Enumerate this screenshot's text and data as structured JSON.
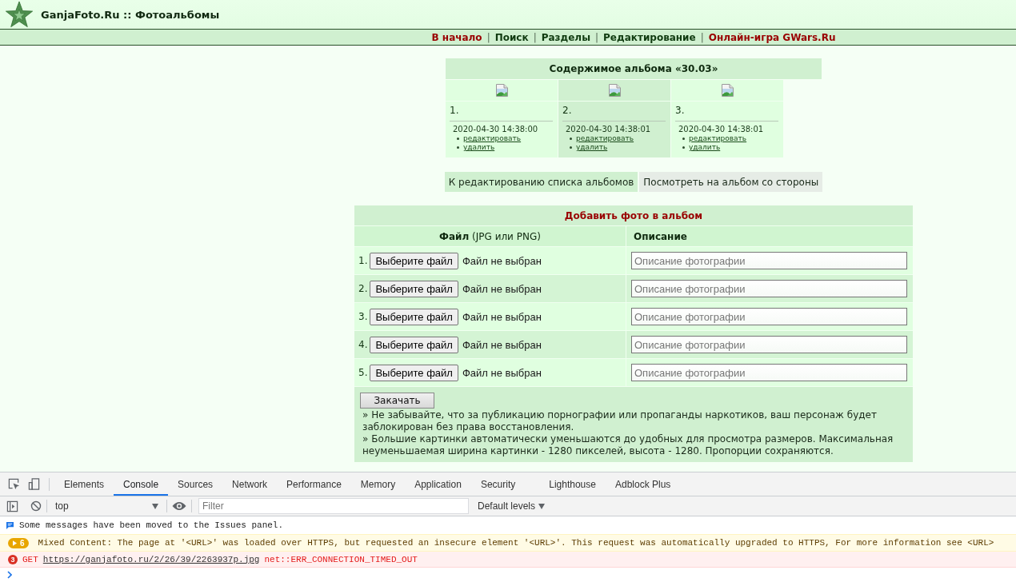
{
  "header": {
    "title": "GanjaFoto.Ru :: Фотоальбомы"
  },
  "nav": [
    {
      "label": "В начало",
      "kind": "accent"
    },
    {
      "label": "|",
      "kind": "separator"
    },
    {
      "label": "Поиск",
      "kind": "link"
    },
    {
      "label": "|",
      "kind": "separator"
    },
    {
      "label": "Разделы",
      "kind": "link"
    },
    {
      "label": "|",
      "kind": "separator"
    },
    {
      "label": "Редактирование",
      "kind": "link"
    },
    {
      "label": "|",
      "kind": "separator"
    },
    {
      "label": "Онлайн-игра GWars.Ru",
      "kind": "accent"
    }
  ],
  "album": {
    "title": "Содержимое альбома «30.03»",
    "photos": [
      {
        "number": "1.",
        "date": "2020-04-30 14:38:00",
        "actions": [
          "редактировать",
          "удалить"
        ]
      },
      {
        "number": "2.",
        "date": "2020-04-30 14:38:01",
        "actions": [
          "редактировать",
          "удалить"
        ]
      },
      {
        "number": "3.",
        "date": "2020-04-30 14:38:01",
        "actions": [
          "редактировать",
          "удалить"
        ]
      }
    ],
    "buttons": [
      {
        "label": "К редактированию списка альбомов",
        "kind": "main"
      },
      {
        "label": "Посмотреть на альбом со стороны",
        "kind": "plain"
      }
    ]
  },
  "upload": {
    "title": "Добавить фото в альбом",
    "columns": [
      "**Файл** (JPG или PNG)",
      "Описание"
    ],
    "rows": [
      {
        "number": "1.",
        "button": "Выберите файл",
        "status": "Файл не выбран",
        "placeholder": "Описание фотографии"
      },
      {
        "number": "2.",
        "button": "Выберите файл",
        "status": "Файл не выбран",
        "placeholder": "Описание фотографии"
      },
      {
        "number": "3.",
        "button": "Выберите файл",
        "status": "Файл не выбран",
        "placeholder": "Описание фотографии"
      },
      {
        "number": "4.",
        "button": "Выберите файл",
        "status": "Файл не выбран",
        "placeholder": "Описание фотографии"
      },
      {
        "number": "5.",
        "button": "Выберите файл",
        "status": "Файл не выбран",
        "placeholder": "Описание фотографии"
      }
    ],
    "submit": "Закачать",
    "notes": [
      "» Не забывайте, что за публикацию порнографии или пропаганды наркотиков, ваш персонаж будет заблокирован без права восстановления.",
      "» Большие картинки автоматически уменьшаются до удобных для просмотра размеров. Максимальная неуменьшаемая ширина картинки - 1280 пикселей, высота - 1280. Пропорции сохраняются."
    ]
  },
  "devtools": {
    "tabs": [
      {
        "label": "Elements",
        "selected": false
      },
      {
        "label": "Console",
        "selected": true
      },
      {
        "label": "Sources",
        "selected": false
      },
      {
        "label": "Network",
        "selected": false
      },
      {
        "label": "Performance",
        "selected": false
      },
      {
        "label": "Memory",
        "selected": false
      },
      {
        "label": "Application",
        "selected": false
      },
      {
        "label": "Security",
        "selected": false
      },
      {
        "label": "Lighthouse",
        "selected": false
      },
      {
        "label": "Adblock Plus",
        "selected": false
      }
    ],
    "context": "top",
    "filter": {
      "placeholder": "Filter"
    },
    "levels": "Default levels",
    "messages": [
      {
        "kind": "info",
        "text": "Some messages have been moved to the Issues panel."
      },
      {
        "kind": "warning",
        "count": "6",
        "text": "Mixed Content: The page at '<URL>' was loaded over HTTPS, but requested an insecure element '<URL>'. This request was automatically upgraded to HTTPS, For more information see <URL>"
      },
      {
        "kind": "error",
        "count": "3",
        "method": "GET",
        "url": "https://ganjafoto.ru/2/26/39/2263937p.jpg",
        "text": "net::ERR_CONNECTION_TIMED_OUT"
      }
    ]
  }
}
